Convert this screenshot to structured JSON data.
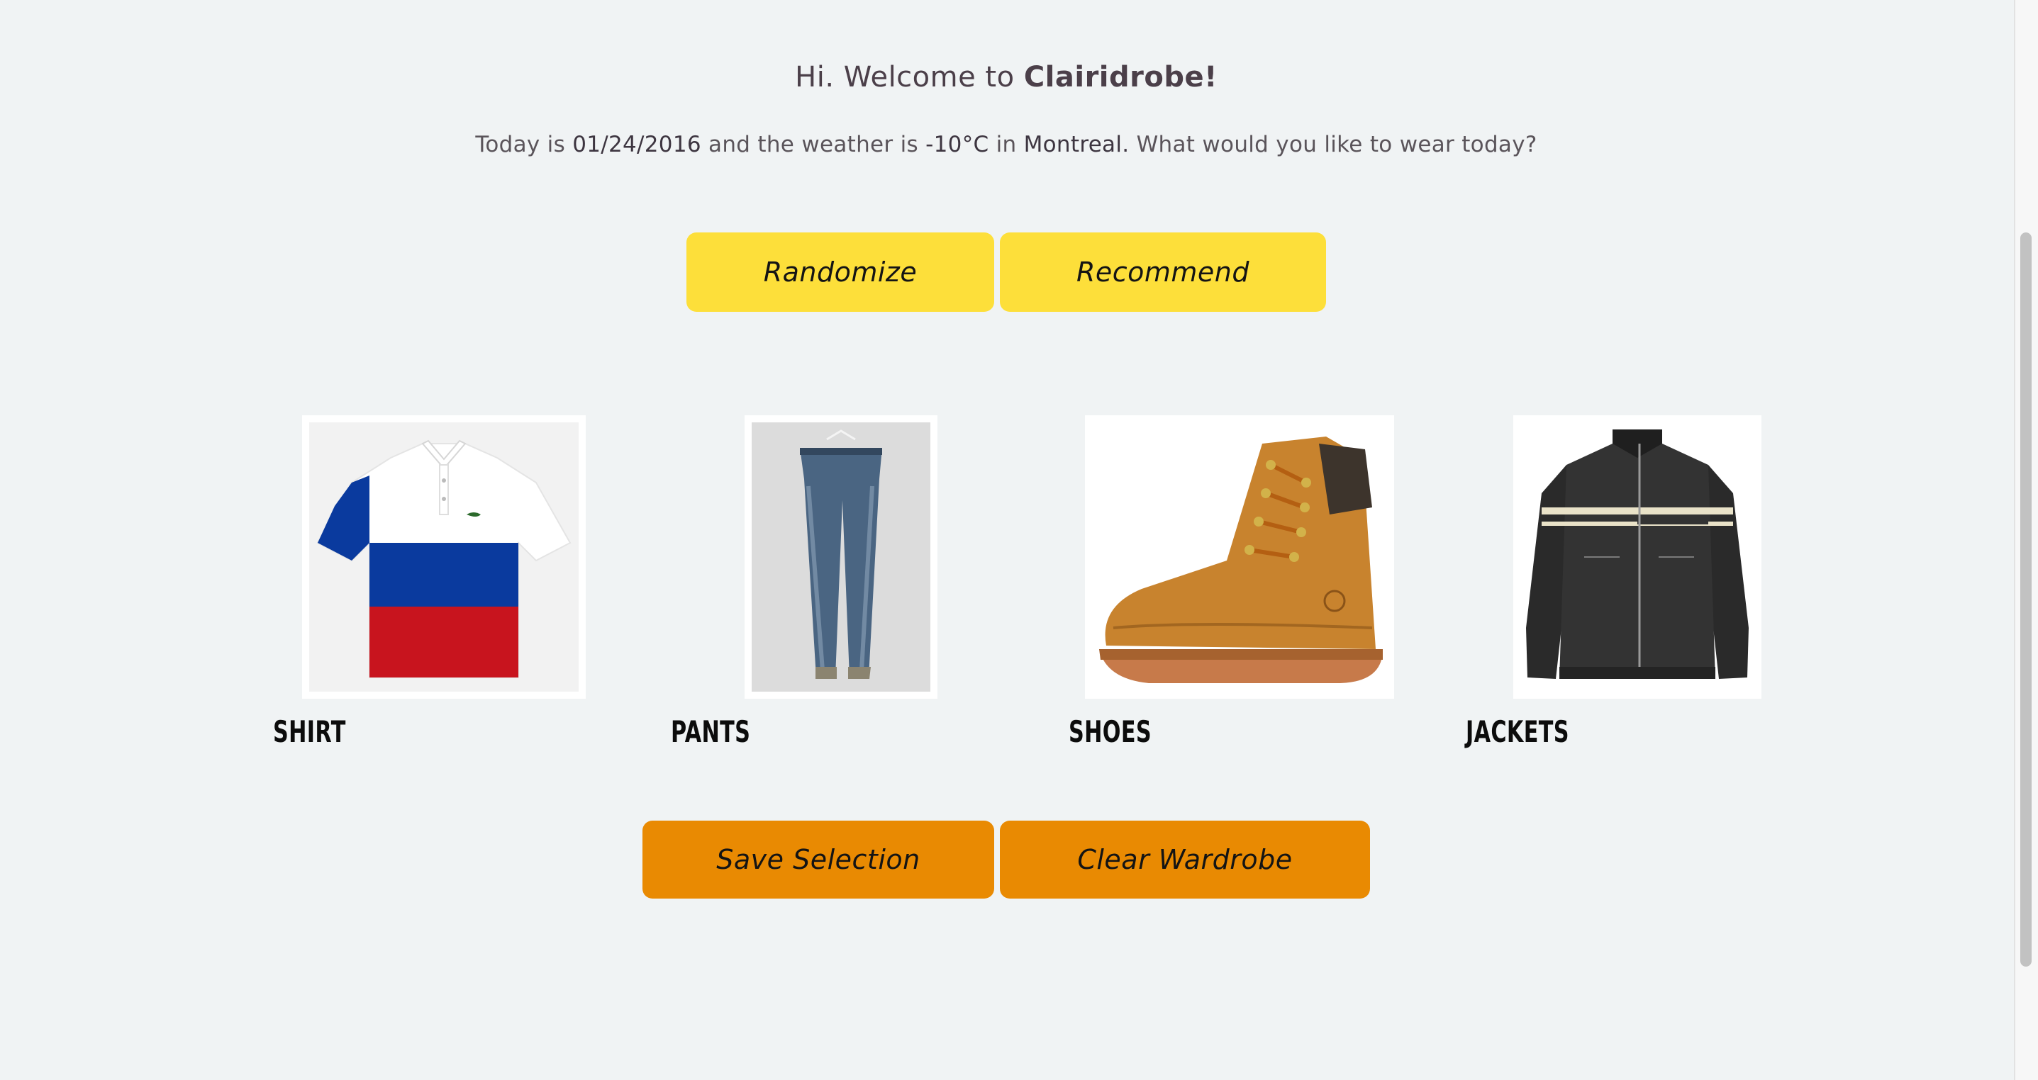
{
  "header": {
    "greeting": "Hi. Welcome to ",
    "app_name": "Clairidrobe!"
  },
  "weather_line": {
    "prefix": "Today is ",
    "date": "01/24/2016",
    "middle": " and the weather is ",
    "temperature": "-10°C",
    "in_text": " in ",
    "city": "Montreal.",
    "question": " What would you like to wear today?"
  },
  "actions": {
    "randomize_label": "Randomize",
    "recommend_label": "Recommend",
    "save_label": "Save Selection",
    "clear_label": "Clear Wardrobe"
  },
  "wardrobe": {
    "items": [
      {
        "label": "SHIRT",
        "image": "polo-shirt-image"
      },
      {
        "label": "PANTS",
        "image": "jeans-image"
      },
      {
        "label": "SHOES",
        "image": "boot-image"
      },
      {
        "label": "JACKETS",
        "image": "leather-jacket-image"
      }
    ]
  },
  "colors": {
    "background": "#f0f3f4",
    "primary_button": "#fddf3a",
    "secondary_button": "#e98a02",
    "text": "#4b3f49"
  }
}
